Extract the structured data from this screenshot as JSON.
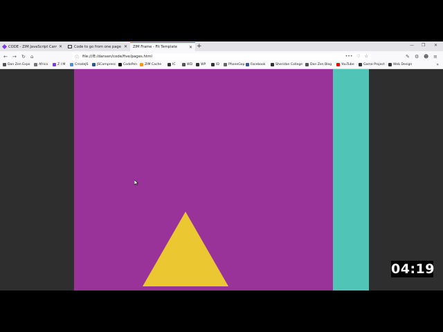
{
  "tabs": [
    {
      "title": "CODE - ZIM JavaScript Canvas ...",
      "favicon_color": "#7b3fe4"
    },
    {
      "title": "Code to go from one page to ...",
      "favicon_color": "#333333"
    },
    {
      "title": "ZIM Frame - Fit Template",
      "favicon_color": "#3399ff"
    }
  ],
  "address": {
    "url": "file:///E:/dansen/code/five/pages.html"
  },
  "bookmarks": [
    {
      "label": "Dan Zen Expo",
      "color": "#555555"
    },
    {
      "label": "Africa",
      "color": "#777777"
    },
    {
      "label": "Z I M",
      "color": "#7b3fe4"
    },
    {
      "label": "CreateJS",
      "color": "#4a90d9"
    },
    {
      "label": "JSCompress",
      "color": "#2b5797"
    },
    {
      "label": "CodePen",
      "color": "#111111"
    },
    {
      "label": "ZIM Cache",
      "color": "#ff9900"
    },
    {
      "label": "IC",
      "color": "#333333"
    },
    {
      "label": "WD",
      "color": "#555555"
    },
    {
      "label": "WP",
      "color": "#333333"
    },
    {
      "label": "ID",
      "color": "#333333"
    },
    {
      "label": "PhoneGap",
      "color": "#666666"
    },
    {
      "label": "Facebook",
      "color": "#3b5998"
    },
    {
      "label": "Sheridan College",
      "color": "#333333"
    },
    {
      "label": "Dan Zen Blog",
      "color": "#555555"
    },
    {
      "label": "YouTube",
      "color": "#ff0000"
    },
    {
      "label": "Game Project",
      "color": "#333333"
    },
    {
      "label": "Web Design",
      "color": "#333333"
    }
  ],
  "stage": {
    "background": "#993399",
    "side_panel": "#50c4b7",
    "triangle_color": "#ebc731"
  },
  "timer": "04:19"
}
